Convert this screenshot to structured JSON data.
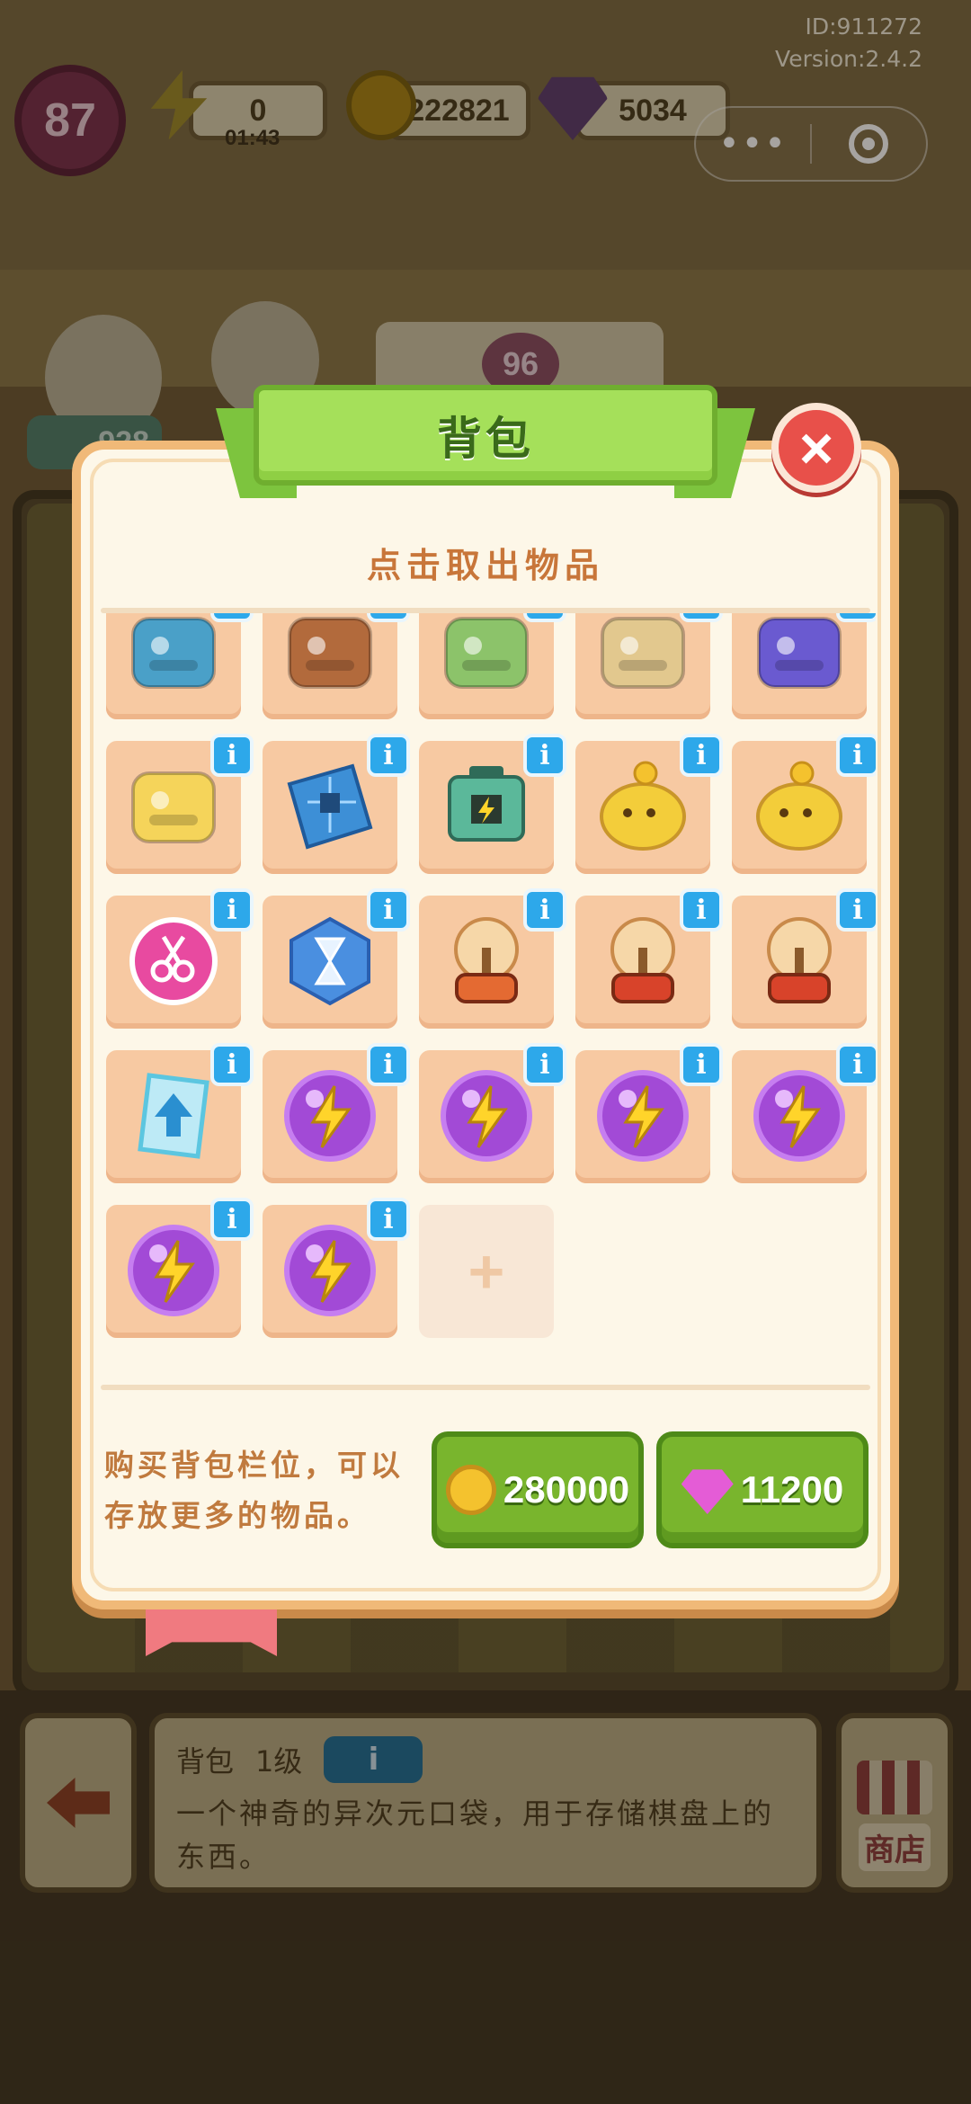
{
  "hud": {
    "id_text": "ID:911272",
    "version_text": "Version:2.4.2",
    "level": "87",
    "energy": "0",
    "energy_timer": "01:43",
    "coins": "222821",
    "gems": "5034",
    "counter": "96",
    "workers": "928"
  },
  "capsule": {
    "more_label": "•••"
  },
  "dialog": {
    "title": "背包",
    "close_label": "×",
    "subtitle": "点击取出物品",
    "info_label": "i",
    "empty_label": "+",
    "buy_text_line1": "购买背包栏位，可以",
    "buy_text_line2": "存放更多的物品。",
    "buy_coin_price": "280000",
    "buy_gem_price": "11200",
    "items": [
      {
        "name": "map-piece",
        "color": "#4aa0c8"
      },
      {
        "name": "wooden-chest",
        "color": "#b26a3c"
      },
      {
        "name": "sleeping-bag",
        "color": "#8cc36a"
      },
      {
        "name": "clover-book",
        "color": "#e2c88e"
      },
      {
        "name": "wizard-toy",
        "color": "#6a5ad0"
      },
      {
        "name": "yellow-bear",
        "color": "#f5d45a"
      },
      {
        "name": "circuit-board",
        "color": "#3d8fd6"
      },
      {
        "name": "battery-case",
        "color": "#5bb89a"
      },
      {
        "name": "chick-coin",
        "color": "#f3cd3a"
      },
      {
        "name": "chick-coin",
        "color": "#f3cd3a"
      },
      {
        "name": "scissors-badge",
        "color": "#e84aa0"
      },
      {
        "name": "hourglass-hex",
        "color": "#4a8fe0"
      },
      {
        "name": "plasma-ball",
        "color": "#e46a32"
      },
      {
        "name": "plasma-ball",
        "color": "#d8432a"
      },
      {
        "name": "plasma-ball",
        "color": "#d8432a"
      },
      {
        "name": "upgrade-card",
        "color": "#5cc6e0"
      },
      {
        "name": "energy-orb",
        "color": "#a24ad6"
      },
      {
        "name": "energy-orb",
        "color": "#a24ad6"
      },
      {
        "name": "energy-orb",
        "color": "#a24ad6"
      },
      {
        "name": "energy-orb",
        "color": "#a24ad6"
      },
      {
        "name": "energy-orb",
        "color": "#a24ad6"
      },
      {
        "name": "energy-orb",
        "color": "#a24ad6"
      }
    ]
  },
  "bottom": {
    "item_title": "背包",
    "item_level": "1级",
    "info_label": "i",
    "description": "一个神奇的异次元口袋，用于存储棋盘上的东西。",
    "shop_label": "商店"
  }
}
